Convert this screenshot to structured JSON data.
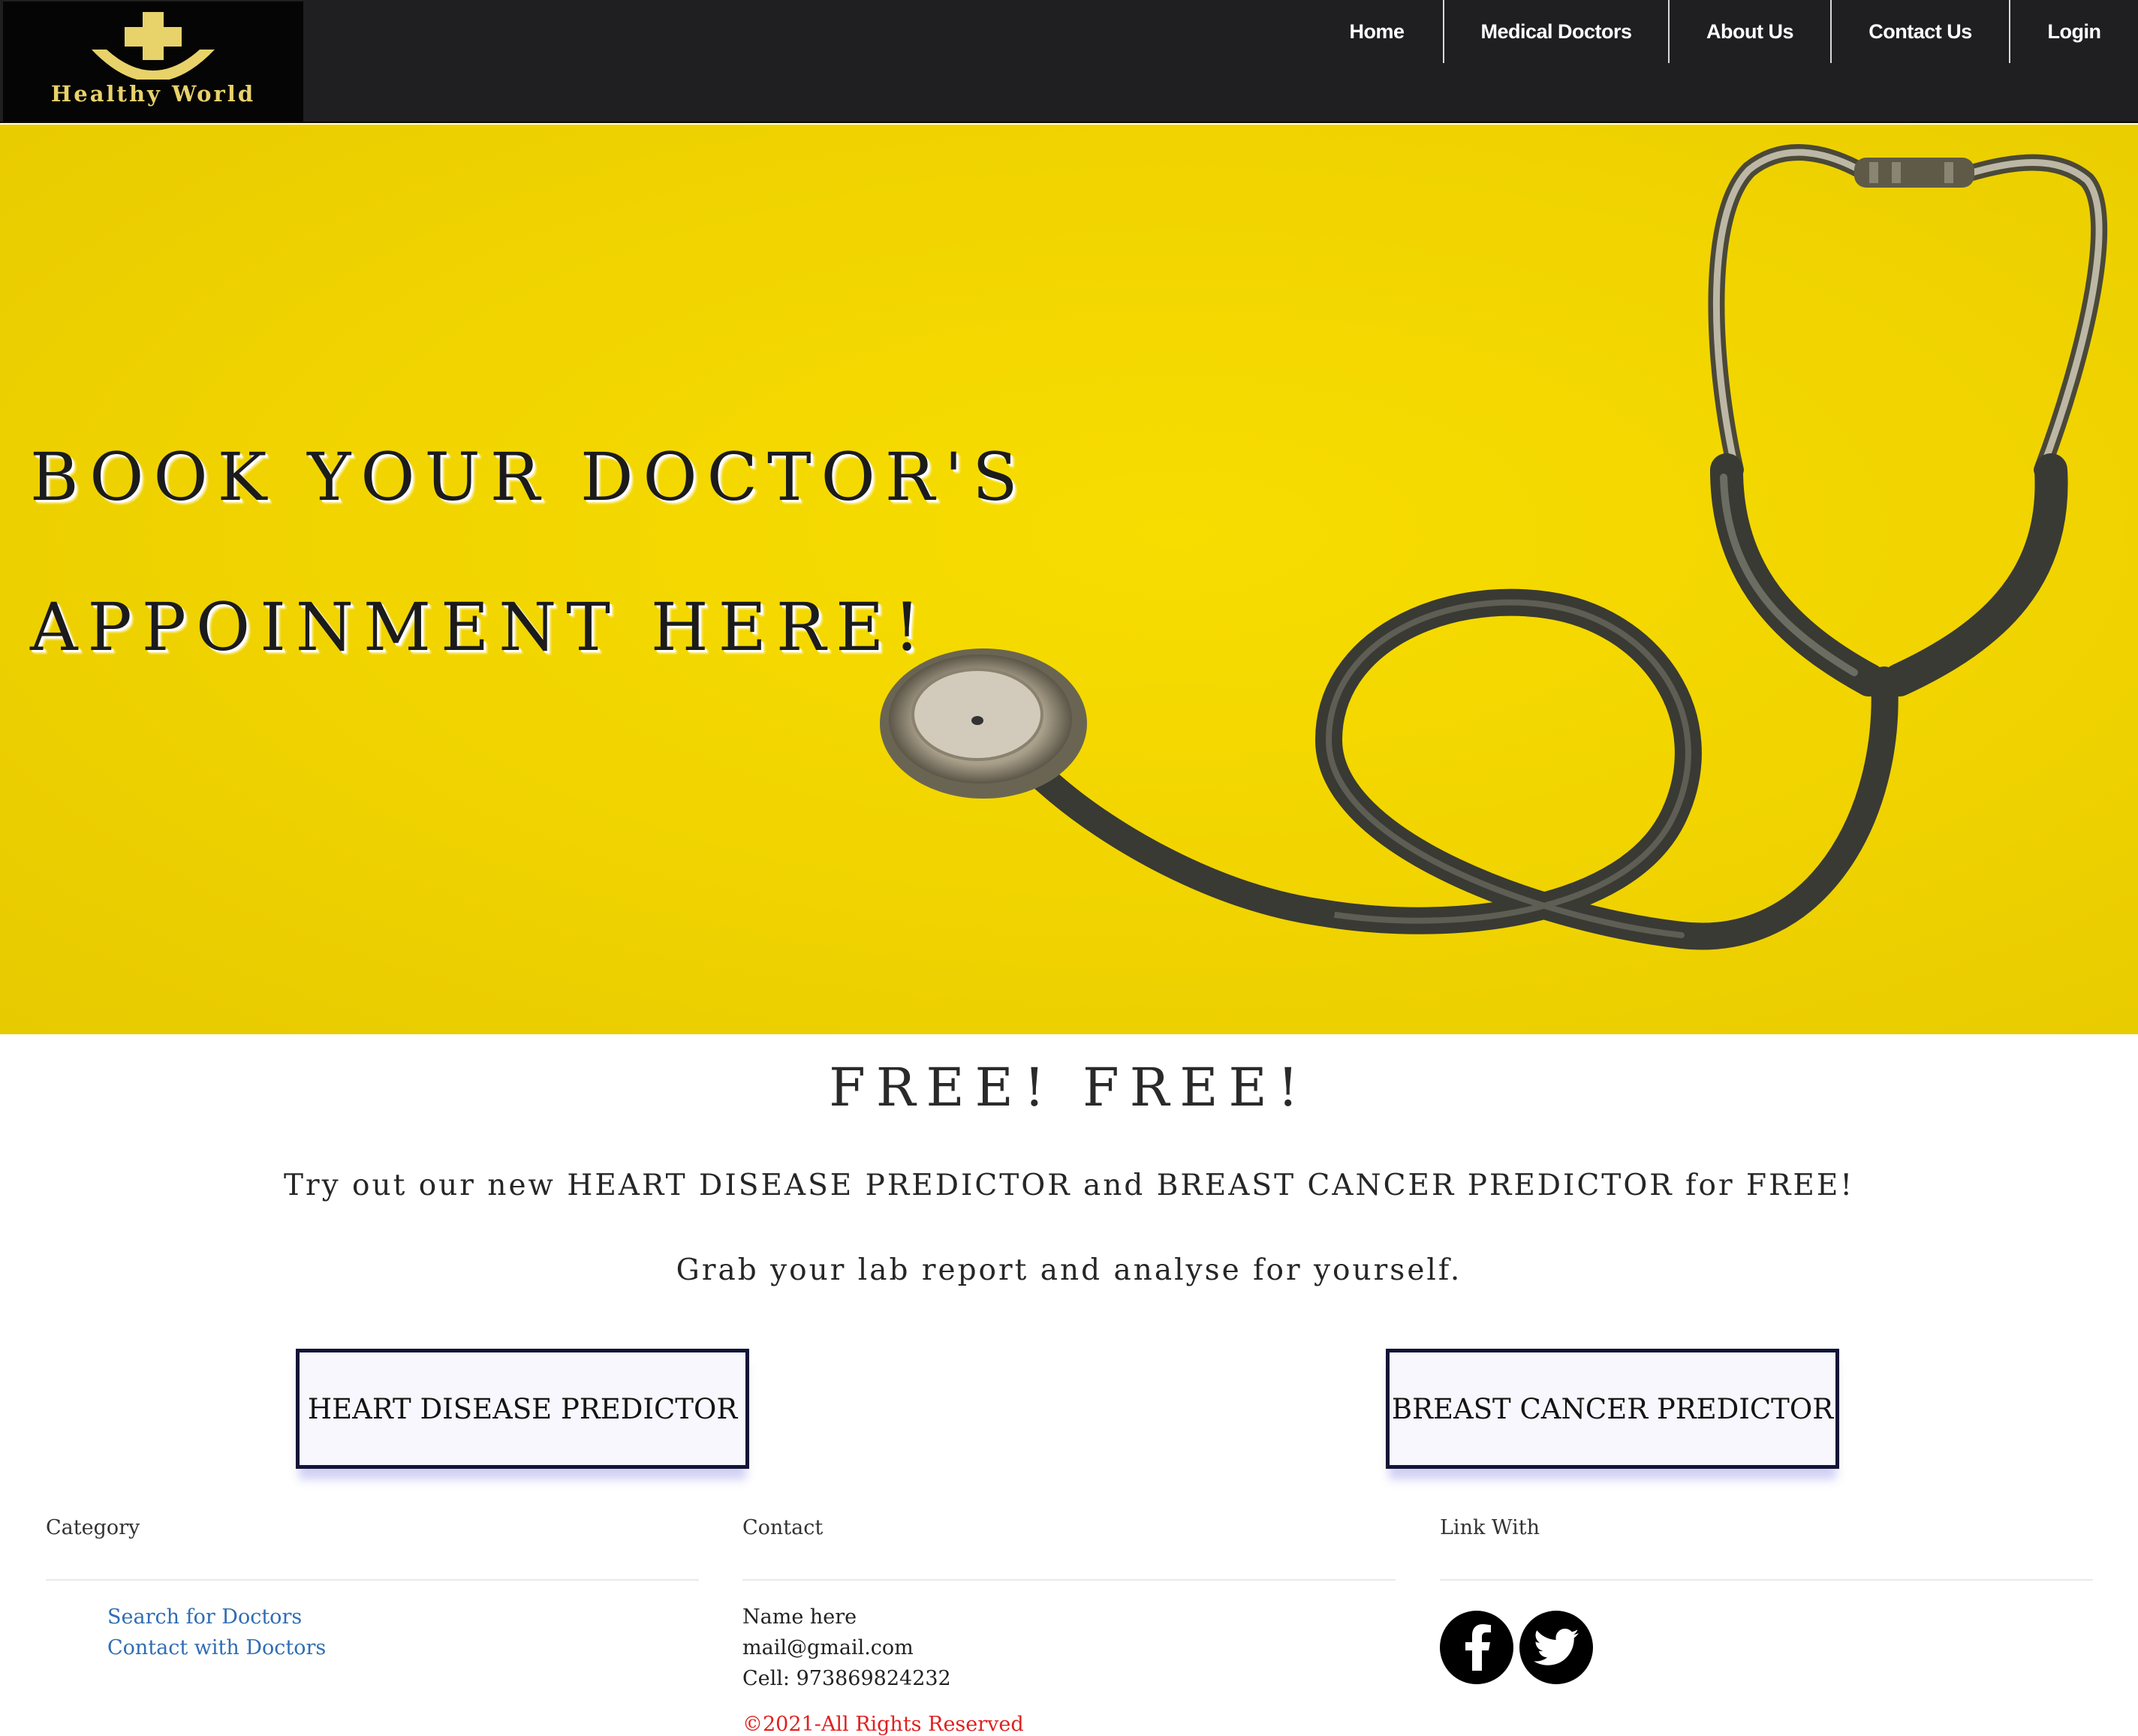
{
  "brand": {
    "name": "Healthy World",
    "logo_icon": "cross-smile-logo-icon",
    "accent": "#e8d26a"
  },
  "nav": {
    "items": [
      {
        "label": "Home",
        "name": "nav-home"
      },
      {
        "label": "Medical Doctors",
        "name": "nav-medical-doctors"
      },
      {
        "label": "About Us",
        "name": "nav-about-us"
      },
      {
        "label": "Contact Us",
        "name": "nav-contact-us"
      },
      {
        "label": "Login",
        "name": "nav-login"
      }
    ]
  },
  "hero": {
    "line1": "BOOK YOUR DOCTOR'S",
    "line2": "APPOINMENT HERE!",
    "background_color": "#f2d500"
  },
  "promo": {
    "title": "FREE! FREE!",
    "line1": "Try out our new HEART DISEASE PREDICTOR and BREAST CANCER PREDICTOR for FREE!",
    "line2": "Grab your lab report and analyse for yourself."
  },
  "buttons": {
    "heart": "HEART DISEASE PREDICTOR",
    "breast": "BREAST CANCER PREDICTOR"
  },
  "footer": {
    "category": {
      "heading": "Category",
      "links": [
        "Search for Doctors",
        "Contact with Doctors"
      ]
    },
    "contact": {
      "heading": "Contact",
      "name": "Name here",
      "email": "mail@gmail.com",
      "cell": "Cell: 973869824232"
    },
    "link_with": {
      "heading": "Link With",
      "icons": [
        "facebook-icon",
        "twitter-icon"
      ]
    },
    "copyright": "©2021-All Rights Reserved"
  }
}
